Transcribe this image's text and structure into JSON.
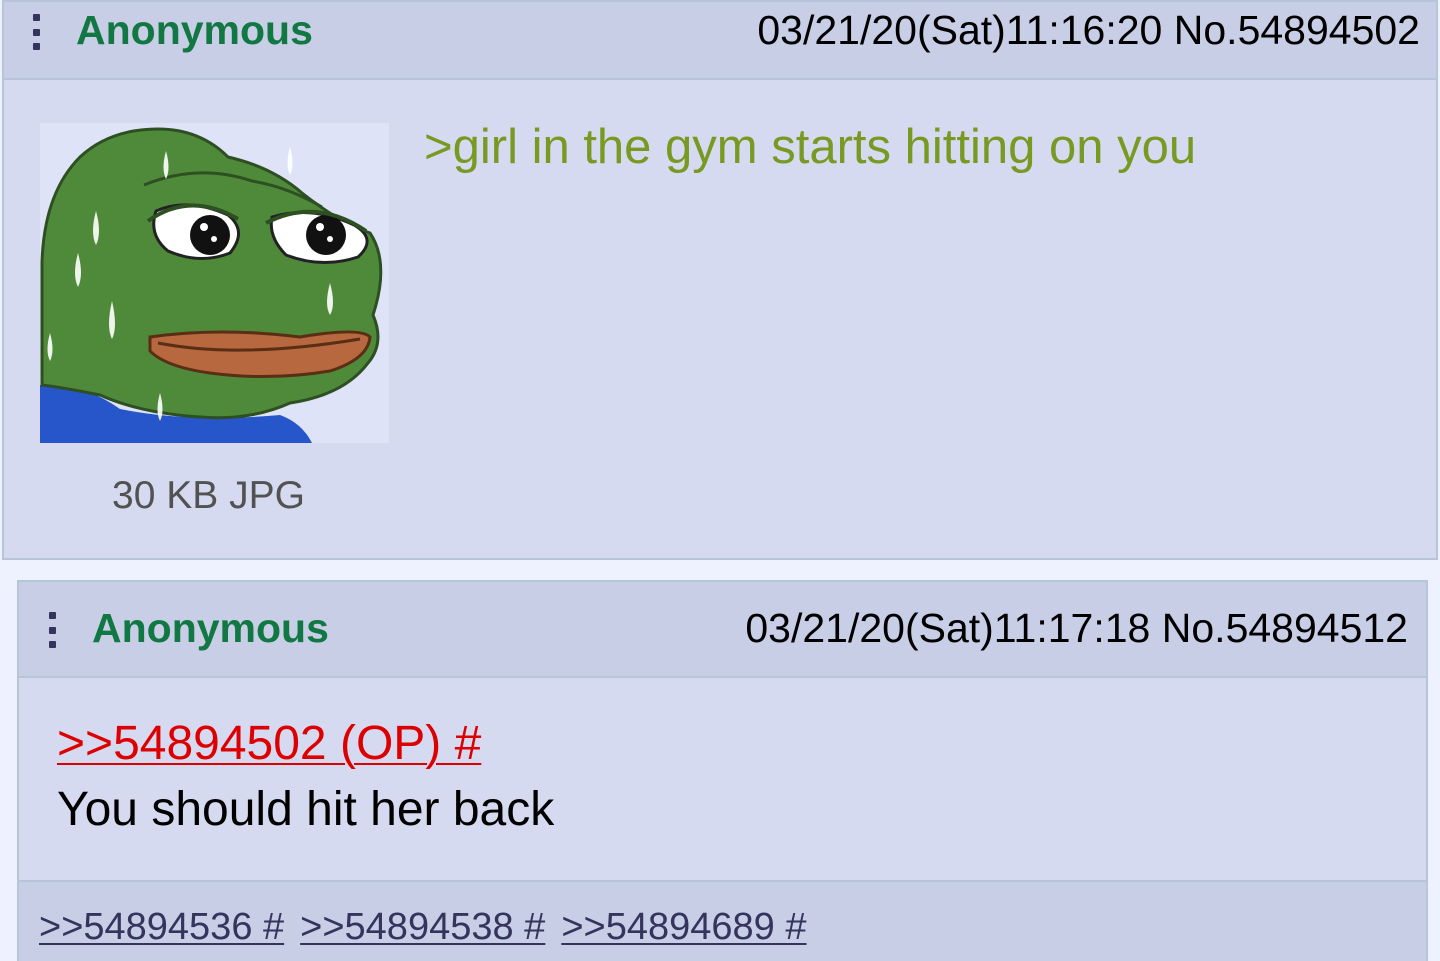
{
  "op": {
    "name": "Anonymous",
    "datetime": "03/21/20(Sat)11:16:20",
    "post_no": "No.54894502",
    "file_info": "30 KB JPG",
    "thumbnail": "sweating-frog-meme",
    "greentext": ">girl in the gym starts hitting on you"
  },
  "reply": {
    "name": "Anonymous",
    "datetime": "03/21/20(Sat)11:17:18",
    "post_no": "No.54894512",
    "quotelink": ">>54894502 (OP) #",
    "comment": "You should hit her back",
    "backlinks": [
      ">>54894536 #",
      ">>54894538 #",
      ">>54894689 #"
    ]
  },
  "colors": {
    "post_bg": "#d6daf0",
    "header_bg": "#c9cee7",
    "name": "#117743",
    "greentext": "#789922",
    "quotelink": "#dd0000",
    "backlink": "#34345c"
  }
}
